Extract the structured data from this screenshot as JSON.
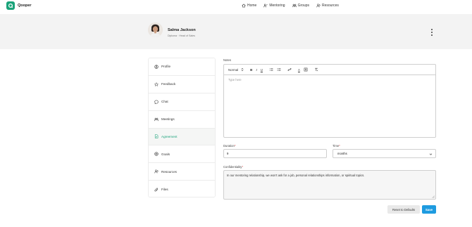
{
  "app": {
    "brand": "Qooper"
  },
  "nav": {
    "items": [
      {
        "label": "Home",
        "icon": "home-icon"
      },
      {
        "label": "Mentoring",
        "icon": "mentoring-icon"
      },
      {
        "label": "Groups",
        "icon": "groups-icon"
      },
      {
        "label": "Resources",
        "icon": "resources-icon"
      }
    ]
  },
  "profile": {
    "name": "Salma Jackson",
    "role": "Diploma · Head of Sales"
  },
  "sidebar": {
    "items": [
      {
        "label": "Profile",
        "icon": "user-circle-icon"
      },
      {
        "label": "Feedback",
        "icon": "star-icon"
      },
      {
        "label": "Chat",
        "icon": "chat-icon"
      },
      {
        "label": "Meetings",
        "icon": "meetings-icon"
      },
      {
        "label": "Agreement",
        "icon": "document-icon",
        "active": true
      },
      {
        "label": "Goals",
        "icon": "target-icon"
      },
      {
        "label": "Resources",
        "icon": "resources-icon"
      },
      {
        "label": "Files",
        "icon": "paperclip-icon"
      }
    ]
  },
  "form": {
    "notes_label": "Notes",
    "toolbar": {
      "style": "Normal",
      "bold": "B",
      "italic": "I",
      "underline": "U",
      "font_color": "A"
    },
    "notes_placeholder": "Type here",
    "duration_label": "Duration",
    "duration_value": "9",
    "time_label": "Time",
    "time_value": "months",
    "required_mark": "*",
    "confidentiality_label": "Confidentiality",
    "confidentiality_value": "In our mentoring relationship, we won't ask for a job, personal relationships information, or spiritual topics."
  },
  "actions": {
    "reset": "Reset to Defaults",
    "save": "Save"
  },
  "colors": {
    "accent": "#1aa37a",
    "primary": "#1e9be0"
  }
}
